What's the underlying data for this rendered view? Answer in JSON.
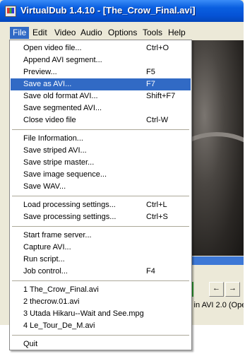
{
  "window": {
    "title": "VirtualDub 1.4.10 - [The_Crow_Final.avi]",
    "status_text": "k in AVI 2.0 (Ope"
  },
  "menubar": [
    "File",
    "Edit",
    "Video",
    "Audio",
    "Options",
    "Tools",
    "Help"
  ],
  "file_menu": {
    "groups": [
      [
        {
          "label": "Open video file...",
          "shortcut": "Ctrl+O"
        },
        {
          "label": "Append AVI segment...",
          "shortcut": ""
        },
        {
          "label": "Preview...",
          "shortcut": "F5"
        },
        {
          "label": "Save as AVI...",
          "shortcut": "F7",
          "highlighted": true
        },
        {
          "label": "Save old format AVI...",
          "shortcut": "Shift+F7"
        },
        {
          "label": "Save segmented AVI...",
          "shortcut": ""
        },
        {
          "label": "Close video file",
          "shortcut": "Ctrl-W"
        }
      ],
      [
        {
          "label": "File Information...",
          "shortcut": ""
        },
        {
          "label": "Save striped AVI...",
          "shortcut": ""
        },
        {
          "label": "Save stripe master...",
          "shortcut": ""
        },
        {
          "label": "Save image sequence...",
          "shortcut": ""
        },
        {
          "label": "Save WAV...",
          "shortcut": ""
        }
      ],
      [
        {
          "label": "Load processing settings...",
          "shortcut": "Ctrl+L"
        },
        {
          "label": "Save processing settings...",
          "shortcut": "Ctrl+S"
        }
      ],
      [
        {
          "label": "Start frame server...",
          "shortcut": ""
        },
        {
          "label": "Capture AVI...",
          "shortcut": ""
        },
        {
          "label": "Run script...",
          "shortcut": ""
        },
        {
          "label": "Job control...",
          "shortcut": "F4"
        }
      ],
      [
        {
          "label": "1 The_Crow_Final.avi",
          "shortcut": ""
        },
        {
          "label": "2 thecrow.01.avi",
          "shortcut": ""
        },
        {
          "label": "3 Utada Hikaru--Wait and See.mpg",
          "shortcut": ""
        },
        {
          "label": "4 Le_Tour_De_M.avi",
          "shortcut": ""
        }
      ],
      [
        {
          "label": "Quit",
          "shortcut": ""
        }
      ]
    ]
  },
  "toolbar": {
    "btn1": "←",
    "btn2": "→"
  },
  "colors": {
    "highlight": "#316ac5",
    "titlebar": "#0553d6"
  }
}
